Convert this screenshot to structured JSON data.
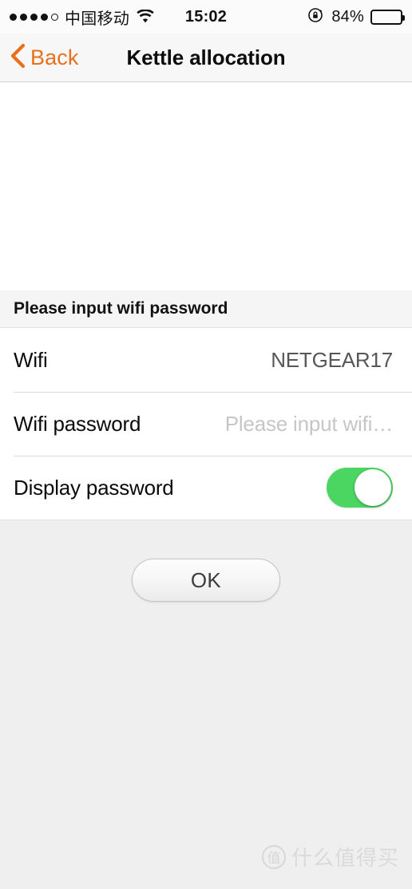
{
  "status_bar": {
    "signal_dots_total": 5,
    "signal_dots_filled": 4,
    "carrier": "中国移动",
    "wifi_icon": "wifi-icon",
    "time": "15:02",
    "rotation_lock_icon": "rotation-lock-icon",
    "battery_percent_label": "84%",
    "battery_fill_ratio": 0.85
  },
  "nav_bar": {
    "back_label": "Back",
    "back_chevron_icon": "chevron-left-icon",
    "title": "Kettle allocation",
    "accent_color": "#e8701c"
  },
  "form": {
    "section_header": "Please input wifi password",
    "rows": [
      {
        "label": "Wifi",
        "value": "NETGEAR17",
        "type": "value"
      },
      {
        "label": "Wifi password",
        "value": "",
        "placeholder": "Please input wifi…",
        "type": "input"
      },
      {
        "label": "Display password",
        "type": "switch",
        "switch_on": true,
        "switch_on_color": "#4bd662"
      }
    ]
  },
  "footer": {
    "ok_label": "OK"
  },
  "watermark": {
    "logo_char": "值",
    "text": "什么值得买"
  }
}
